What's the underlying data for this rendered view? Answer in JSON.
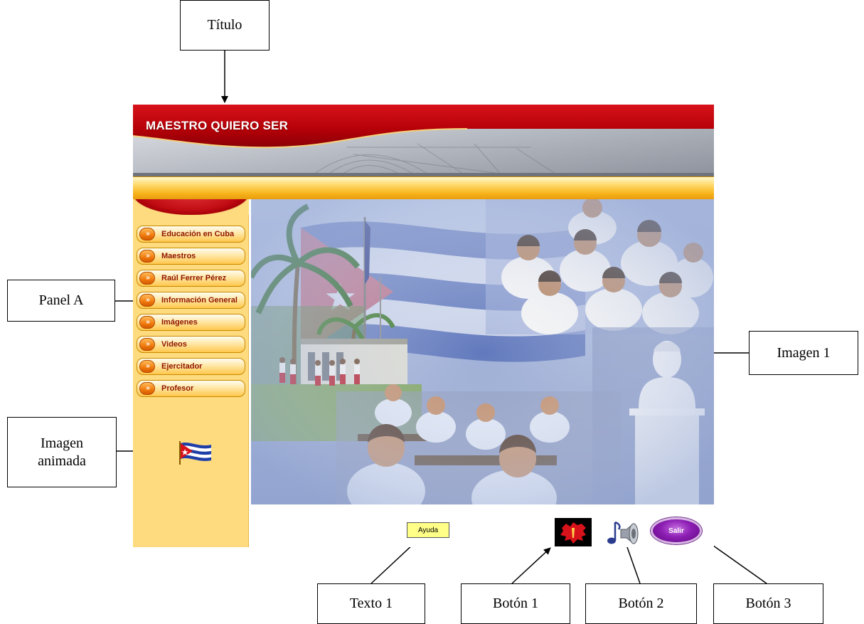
{
  "callouts": {
    "titulo": "Título",
    "panel_a": "Panel A",
    "imagen_animada_line1": "Imagen",
    "imagen_animada_line2": "animada",
    "imagen_1": "Imagen 1",
    "texto_1": "Texto 1",
    "boton_1": "Botón 1",
    "boton_2": "Botón 2",
    "boton_3": "Botón 3"
  },
  "app": {
    "title": "MAESTRO QUIERO SER",
    "menu": [
      {
        "label": "Educación en Cuba",
        "icon": "double-chevron-right-icon"
      },
      {
        "label": "Maestros",
        "icon": "double-chevron-right-icon"
      },
      {
        "label": "Raúl Ferrer Pérez",
        "icon": "double-chevron-right-icon"
      },
      {
        "label": "Información General",
        "icon": "double-chevron-right-icon"
      },
      {
        "label": "Imágenes",
        "icon": "double-chevron-right-icon"
      },
      {
        "label": "Videos",
        "icon": "double-chevron-right-icon"
      },
      {
        "label": "Ejercitador",
        "icon": "double-chevron-right-icon"
      },
      {
        "label": "Profesor",
        "icon": "double-chevron-right-icon"
      }
    ],
    "menu_bullet": "»",
    "help_label": "Ayuda",
    "exit_label": "Salir",
    "button_1_icon": "cuba-map-icon",
    "button_2_icon": "speaker-music-icon",
    "animated_image_icon": "cuban-flag-icon"
  },
  "colors": {
    "banner_red": "#b30008",
    "sidebar_bg": "#fddb7e",
    "menu_text": "#8e1500",
    "gold": "#f7b31a",
    "exit_purple": "#8d1fb4"
  }
}
